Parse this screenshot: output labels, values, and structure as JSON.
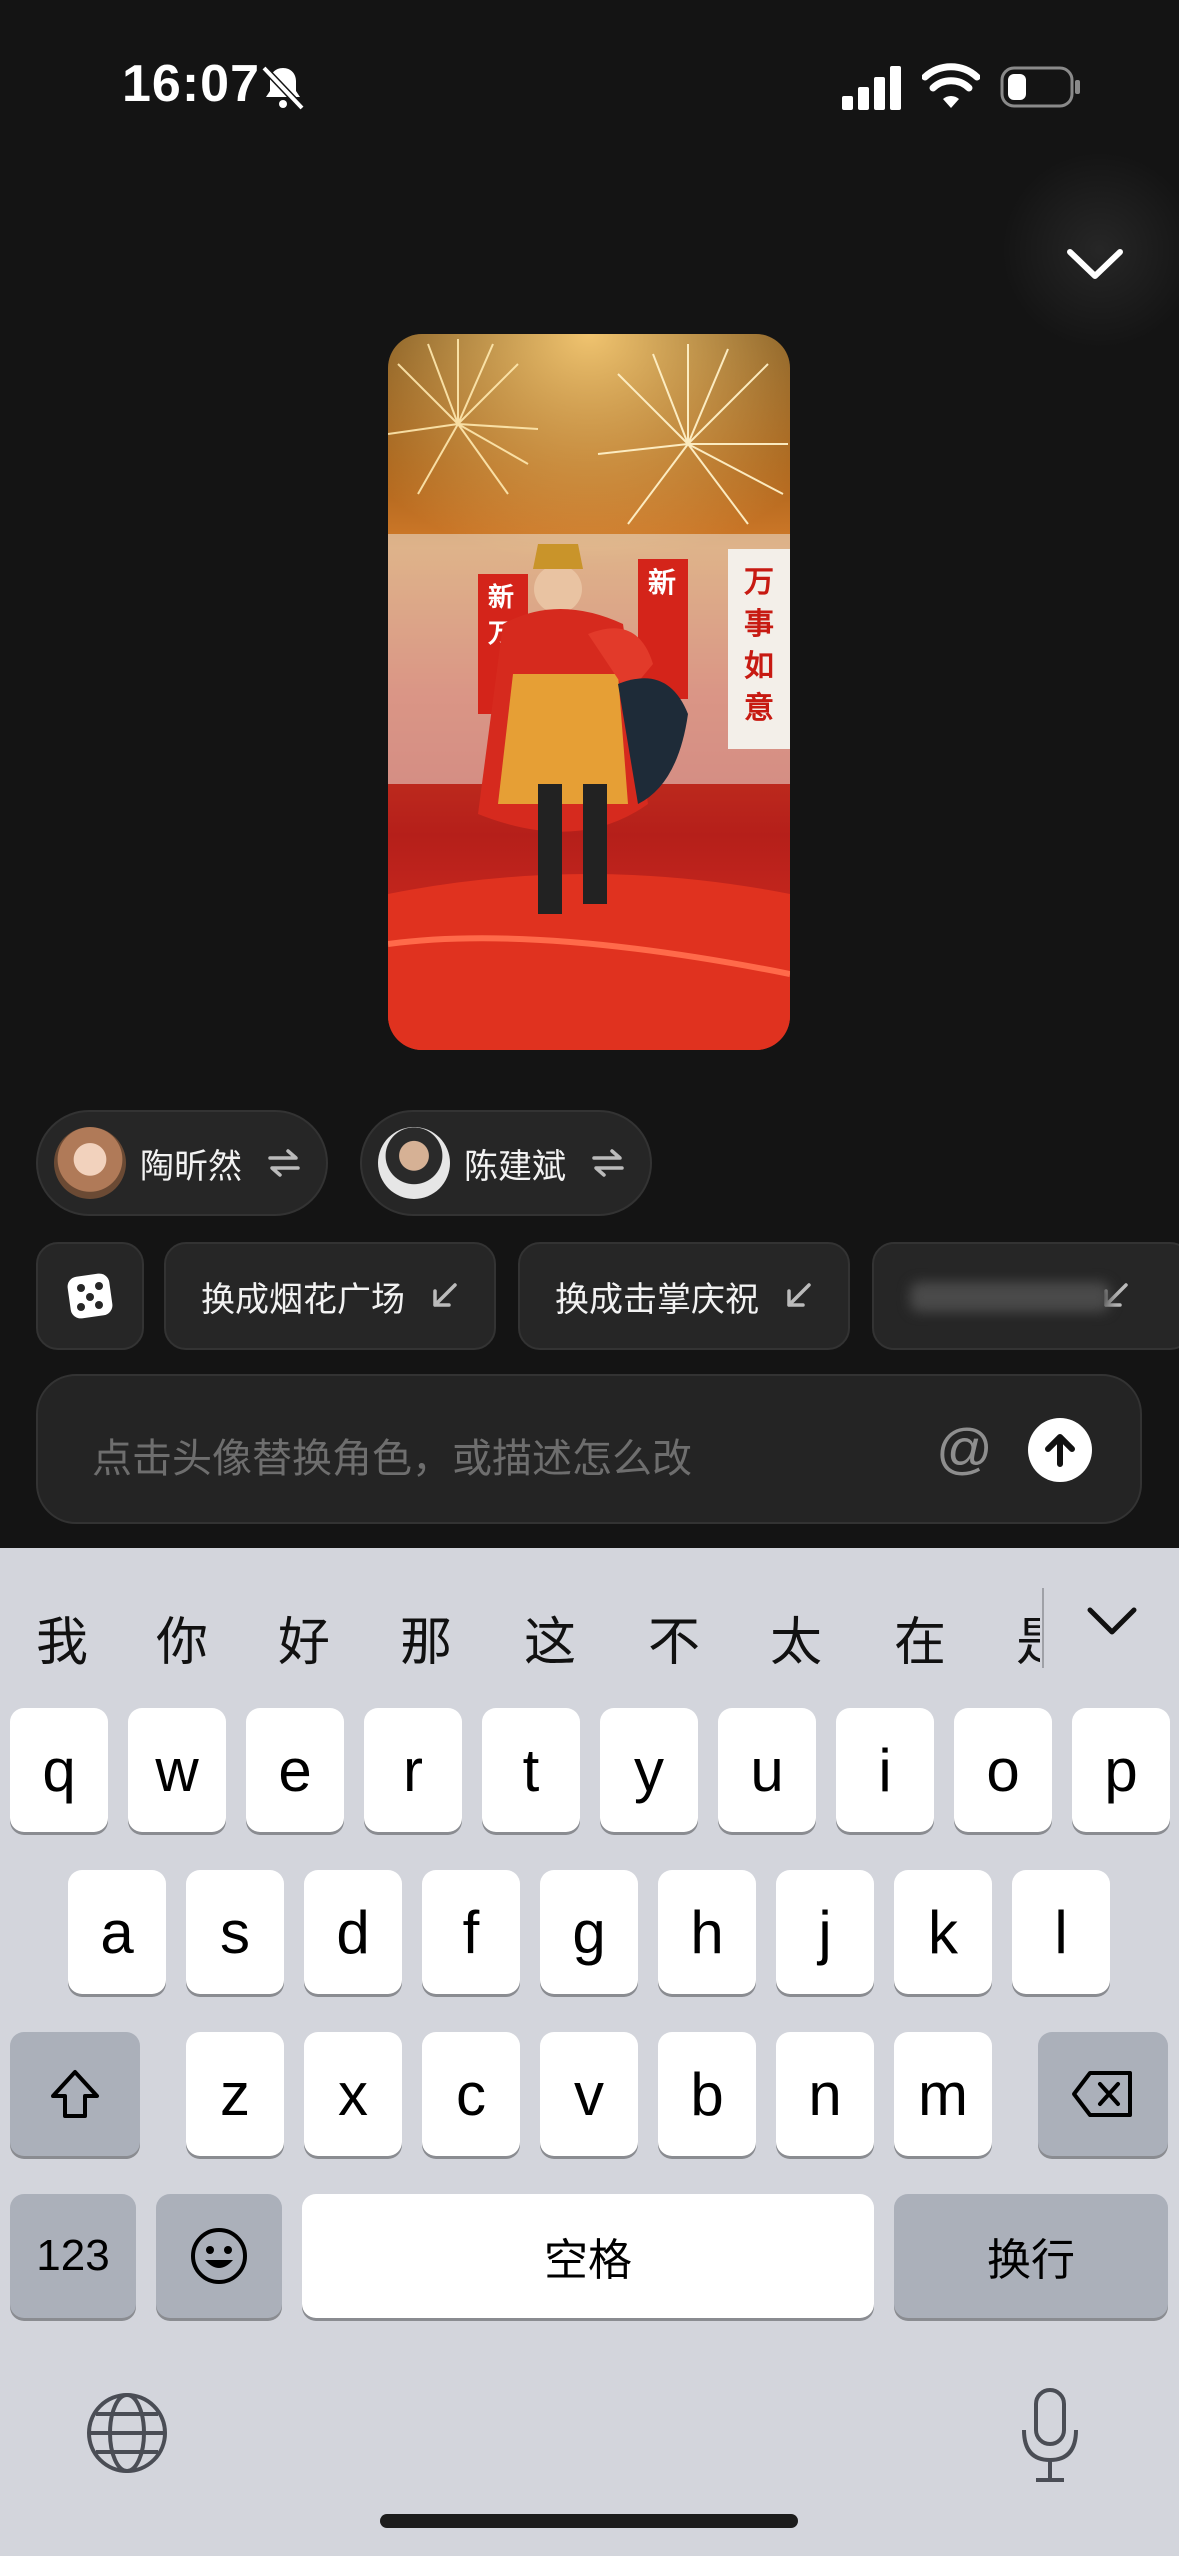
{
  "status_bar": {
    "time": "16:07"
  },
  "preview": {
    "banner_left_top": "新",
    "banner_left_bottom": "万",
    "banner_mid": "新",
    "banner_right": [
      "万",
      "事",
      "如",
      "意"
    ]
  },
  "characters": [
    {
      "name": "陶昕然"
    },
    {
      "name": "陈建斌"
    }
  ],
  "suggestions": [
    {
      "label": "换成烟花广场"
    },
    {
      "label": "换成击掌庆祝"
    }
  ],
  "input": {
    "placeholder": "点击头像替换角色，或描述怎么改",
    "at_symbol": "@"
  },
  "keyboard": {
    "candidates": [
      "我",
      "你",
      "好",
      "那",
      "这",
      "不",
      "太",
      "在",
      "是"
    ],
    "row1": [
      "q",
      "w",
      "e",
      "r",
      "t",
      "y",
      "u",
      "i",
      "o",
      "p"
    ],
    "row2": [
      "a",
      "s",
      "d",
      "f",
      "g",
      "h",
      "j",
      "k",
      "l"
    ],
    "row3": [
      "z",
      "x",
      "c",
      "v",
      "b",
      "n",
      "m"
    ],
    "numbers_label": "123",
    "space_label": "空格",
    "return_label": "换行"
  }
}
